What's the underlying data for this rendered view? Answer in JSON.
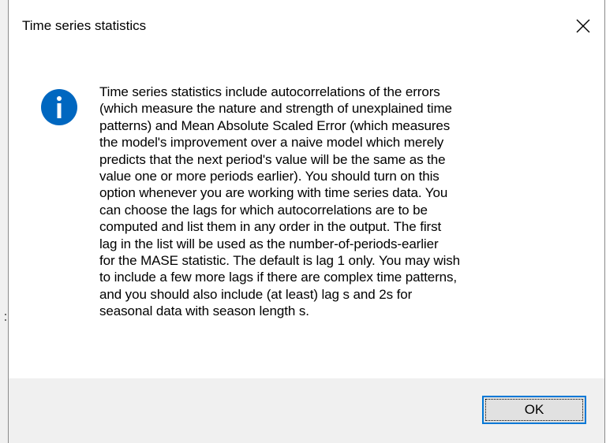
{
  "dialog": {
    "title": "Time series statistics",
    "message": "Time series statistics include autocorrelations of the errors\n(which measure the nature and strength of unexplained time\npatterns) and Mean Absolute Scaled Error (which measures\nthe model's improvement over a naive model which merely\npredicts that the next period's value will be the same as the\nvalue one or more periods earlier).  You should turn on this\noption whenever you are working with time series data.  You\ncan choose the lags for which autocorrelations are to be\ncomputed and list them in any order in the output.  The first\nlag in the list will be used as the number-of-periods-earlier\nfor the MASE statistic.  The default is lag 1 only.  You may wish\nto include a few more lags if there are complex time patterns,\nand you should also include (at least) lag s and 2s for\nseasonal data with season length s.",
    "icon": "info-icon",
    "ok_label": "OK",
    "close_icon": "close-icon"
  },
  "colors": {
    "info_icon_fill": "#0067c0",
    "footer_background": "#f0f0f0",
    "button_focus_border": "#0078d7",
    "button_background": "#e1e1e1"
  }
}
